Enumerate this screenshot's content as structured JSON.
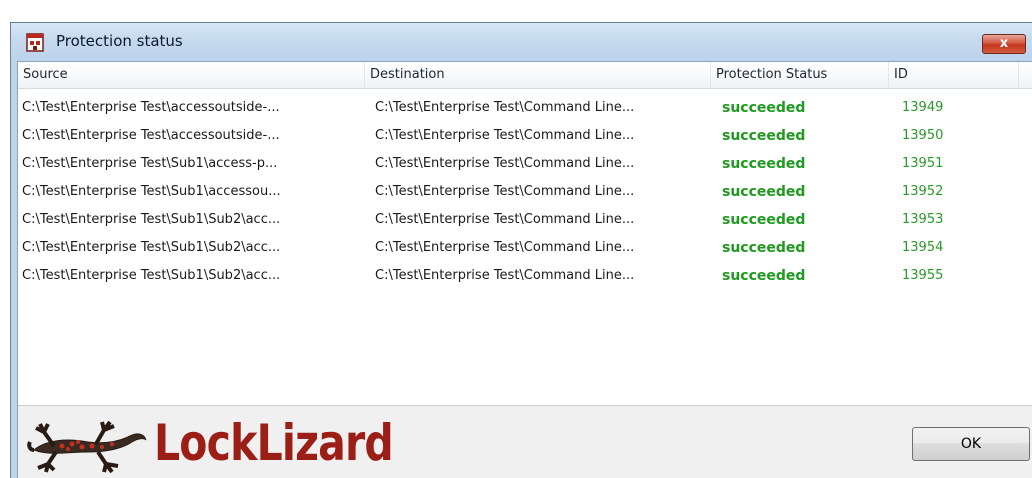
{
  "window": {
    "title": "Protection status",
    "close_label": "x"
  },
  "table": {
    "columns": [
      "Source",
      "Destination",
      "Protection Status",
      "ID"
    ],
    "rows": [
      {
        "source": "C:\\Test\\Enterprise Test\\accessoutside-...",
        "destination": "C:\\Test\\Enterprise Test\\Command Line...",
        "status": "succeeded",
        "id": "13949"
      },
      {
        "source": "C:\\Test\\Enterprise Test\\accessoutside-...",
        "destination": "C:\\Test\\Enterprise Test\\Command Line...",
        "status": "succeeded",
        "id": "13950"
      },
      {
        "source": "C:\\Test\\Enterprise Test\\Sub1\\access-p...",
        "destination": "C:\\Test\\Enterprise Test\\Command Line...",
        "status": "succeeded",
        "id": "13951"
      },
      {
        "source": "C:\\Test\\Enterprise Test\\Sub1\\accessou...",
        "destination": "C:\\Test\\Enterprise Test\\Command Line...",
        "status": "succeeded",
        "id": "13952"
      },
      {
        "source": "C:\\Test\\Enterprise Test\\Sub1\\Sub2\\acc...",
        "destination": "C:\\Test\\Enterprise Test\\Command Line...",
        "status": "succeeded",
        "id": "13953"
      },
      {
        "source": "C:\\Test\\Enterprise Test\\Sub1\\Sub2\\acc...",
        "destination": "C:\\Test\\Enterprise Test\\Command Line...",
        "status": "succeeded",
        "id": "13954"
      },
      {
        "source": "C:\\Test\\Enterprise Test\\Sub1\\Sub2\\acc...",
        "destination": "C:\\Test\\Enterprise Test\\Command Line...",
        "status": "succeeded",
        "id": "13955"
      }
    ]
  },
  "footer": {
    "logo_text": "LockLizard",
    "ok_label": "OK"
  },
  "colors": {
    "status_green": "#1e9a1e",
    "logo_red": "#9b1f16",
    "title_bg": "#c5d9ee"
  }
}
